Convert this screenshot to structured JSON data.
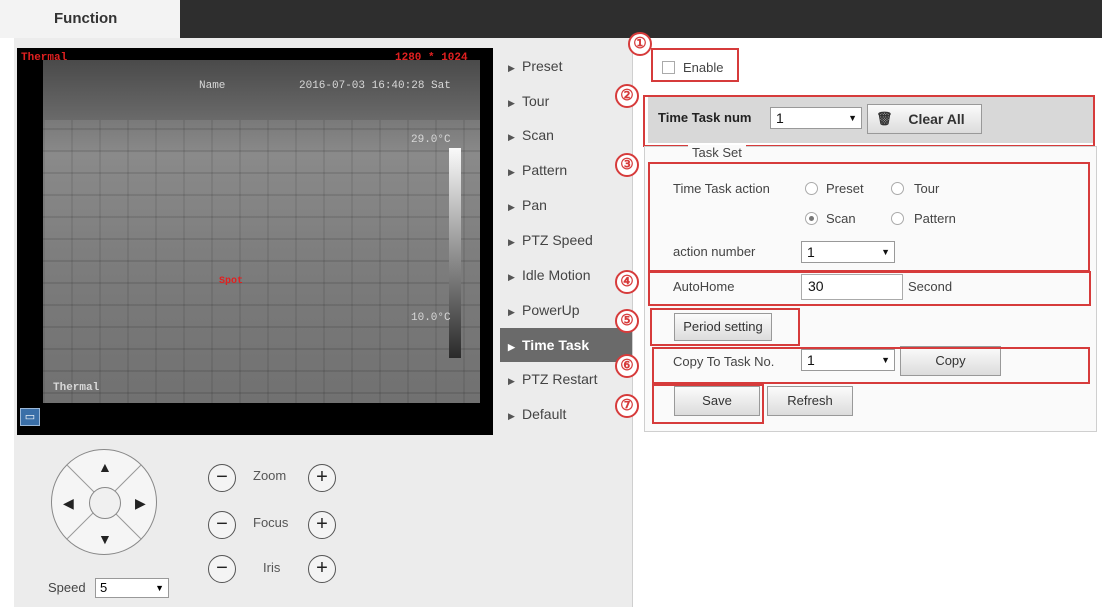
{
  "header": {
    "function_tab": "Function"
  },
  "video": {
    "title_left": "Thermal",
    "title_right": "1280 * 1024",
    "camera_name": "Name",
    "timestamp": "2016-07-03 16:40:28 Sat",
    "temp_high": "29.0°C",
    "temp_low": "10.0°C",
    "spot_label": "Spot",
    "channel_label": "Thermal"
  },
  "menu": {
    "items": [
      {
        "label": "Preset"
      },
      {
        "label": "Tour"
      },
      {
        "label": "Scan"
      },
      {
        "label": "Pattern"
      },
      {
        "label": "Pan"
      },
      {
        "label": "PTZ Speed"
      },
      {
        "label": "Idle Motion"
      },
      {
        "label": "PowerUp"
      },
      {
        "label": "Time Task"
      },
      {
        "label": "PTZ Restart"
      },
      {
        "label": "Default"
      }
    ],
    "active": "Time Task"
  },
  "ptz": {
    "zoom": "Zoom",
    "focus": "Focus",
    "iris": "Iris",
    "minus": "−",
    "plus": "+",
    "speed_label": "Speed",
    "speed_value": "5"
  },
  "form": {
    "enable_label": "Enable",
    "time_task_num_label": "Time Task num",
    "time_task_num_value": "1",
    "clear_all": "Clear All",
    "task_set_title": "Task Set",
    "time_task_action_label": "Time Task action",
    "actions": [
      "Preset",
      "Tour",
      "Scan",
      "Pattern"
    ],
    "selected_action": "Scan",
    "action_number_label": "action number",
    "action_number_value": "1",
    "autohome_label": "AutoHome",
    "autohome_value": "30",
    "autohome_unit": "Second",
    "period_setting": "Period setting",
    "copy_to_label": "Copy To Task No.",
    "copy_to_value": "1",
    "copy_button": "Copy",
    "save_button": "Save",
    "refresh_button": "Refresh"
  },
  "annotations": [
    "①",
    "②",
    "③",
    "④",
    "⑤",
    "⑥",
    "⑦"
  ],
  "colors": {
    "annotation_red": "#d63b3b",
    "active_menu_bg": "#6a6a6a",
    "topbar": "#2e2e2e"
  }
}
